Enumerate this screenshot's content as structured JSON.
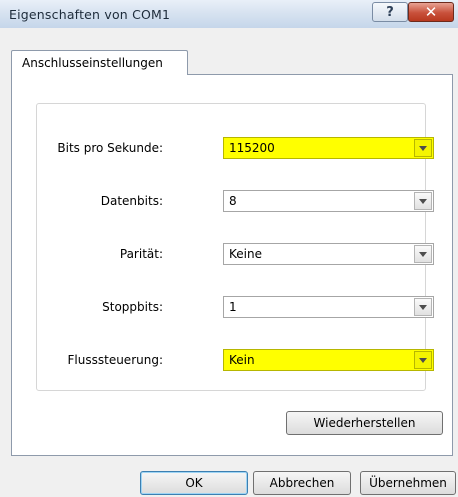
{
  "window": {
    "title": "Eigenschaften von COM1",
    "help_glyph": "?",
    "close_glyph": "✕"
  },
  "tabs": [
    {
      "label": "Anschlusseinstellungen",
      "selected": true
    }
  ],
  "fields": {
    "bits_per_second": {
      "label": "Bits pro Sekunde:",
      "value": "115200",
      "highlight": "#ffff00"
    },
    "data_bits": {
      "label": "Datenbits:",
      "value": "8"
    },
    "parity": {
      "label": "Parität:",
      "value": "Keine"
    },
    "stop_bits": {
      "label": "Stoppbits:",
      "value": "1"
    },
    "flow_control": {
      "label": "Flusssteuerung:",
      "value": "Kein",
      "highlight": "#ffff00"
    }
  },
  "buttons": {
    "restore": "Wiederherstellen",
    "ok": "OK",
    "cancel": "Abbrechen",
    "apply": "Übernehmen"
  }
}
